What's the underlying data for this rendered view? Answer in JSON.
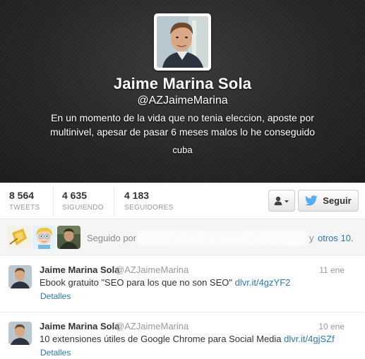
{
  "profile": {
    "full_name": "Jaime Marina Sola",
    "screen_name": "@AZJaimeMarina",
    "bio": "En un momento de la vida que no tenia eleccion, aposte por multinivel, apesar de pasar 6 meses malos lo he conseguido",
    "location": "cuba"
  },
  "stats": [
    {
      "value": "8 564",
      "label": "TWEETS"
    },
    {
      "value": "4 635",
      "label": "SIGUIENDO"
    },
    {
      "value": "4 183",
      "label": "SEGUIDORES"
    }
  ],
  "actions": {
    "follow_label": "Seguir",
    "user_menu_icon": "user-caret-icon"
  },
  "followed_by": {
    "prefix": "Seguido por",
    "and": "y",
    "more": "otros 10."
  },
  "tweets": [
    {
      "name": "Jaime Marina Sola",
      "handle": "@AZJaimeMarina",
      "time": "11 ene",
      "text": "Ebook gratuito \"SEO para los que no son SEO\"",
      "link": "dlvr.it/4gzYF2",
      "details": "Detalles"
    },
    {
      "name": "Jaime Marina Sola",
      "handle": "@AZJaimeMarina",
      "time": "10 ene",
      "text": "10 extensiones útiles de Google Chrome para Social Media",
      "link": "dlvr.it/4gjSZf",
      "details": "Detalles"
    }
  ],
  "colors": {
    "header_bg": "#252525",
    "link": "#2a7ab0",
    "twitter_blue": "#55acee"
  }
}
